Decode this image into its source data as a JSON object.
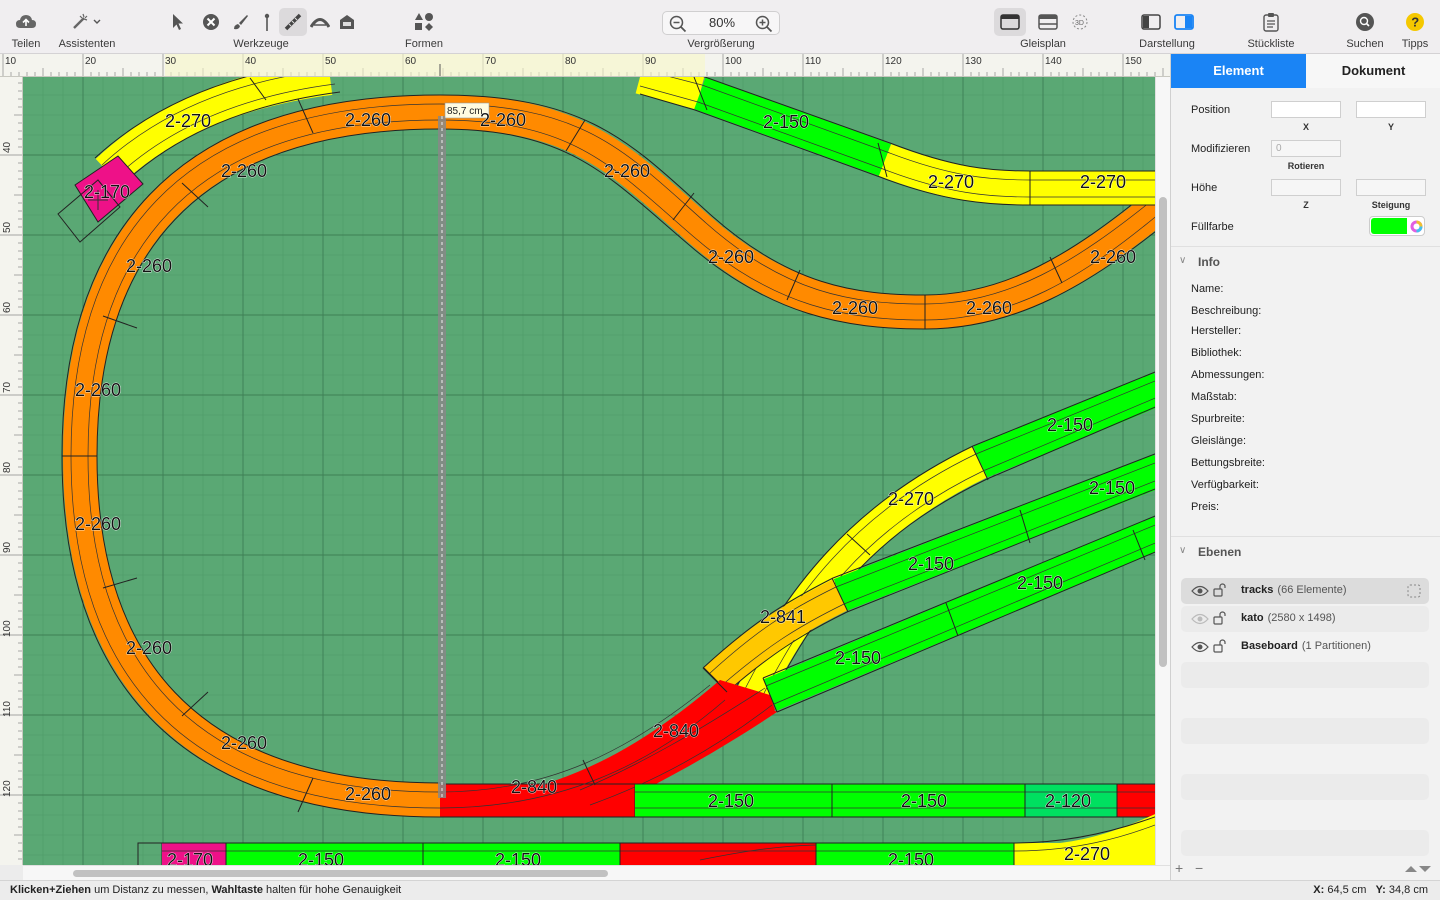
{
  "toolbar": {
    "share": "Teilen",
    "assistants": "Assistenten",
    "tools": "Werkzeuge",
    "shapes": "Formen",
    "zoom_label": "Vergrößerung",
    "zoom_value": "80%",
    "trackplan": "Gleisplan",
    "view": "Darstellung",
    "bom": "Stückliste",
    "search": "Suchen",
    "tips": "Tipps"
  },
  "ruler_top": [
    "10",
    "20",
    "30",
    "40",
    "50",
    "60",
    "70",
    "80",
    "90",
    "100",
    "110",
    "120",
    "130",
    "140",
    "150"
  ],
  "ruler_left": [
    "40",
    "50",
    "60",
    "70",
    "80",
    "90",
    "100",
    "110",
    "120"
  ],
  "canvas": {
    "measure_label": "85,7 cm",
    "colors": {
      "background": "#5aa874",
      "orange": "#ff8a00",
      "yellow": "#ffff00",
      "green": "#00ff00",
      "red": "#ff0000",
      "magenta": "#ee1188",
      "gold": "#ffc800",
      "teal_green": "#00e060"
    },
    "labels": {
      "l1": "2-270",
      "l2": "2-170",
      "l3": "2-260",
      "l4": "2-260",
      "l5": "2-260",
      "l6": "2-260",
      "l7": "2-260",
      "l8": "2-260",
      "l9": "2-260",
      "l10": "2-260",
      "l11": "2-260",
      "l12": "2-260",
      "l13": "2-260",
      "l14": "2-260",
      "l15": "2-260",
      "l16": "2-260",
      "l17": "2-150",
      "l18": "2-270",
      "l19": "2-270",
      "l20": "2-150",
      "l21": "2-150",
      "l22": "2-270",
      "l23": "2-150",
      "l24": "2-150",
      "l25": "2-841",
      "l26": "2-150",
      "l27": "2-840",
      "l28": "2-840",
      "l29": "2-150",
      "l30": "2-150",
      "l31": "2-120",
      "l32": "2-170",
      "l33": "2-150",
      "l34": "2-150",
      "l35": "2-150",
      "l36": "2-270"
    }
  },
  "status": {
    "hint_bold1": "Klicken+Ziehen",
    "hint_text1": " um Distanz zu messen, ",
    "hint_bold2": "Wahltaste",
    "hint_text2": " halten für hohe Genauigkeit",
    "x_label": "X:",
    "x_value": " 64,5 cm",
    "y_label": "Y:",
    "y_value": " 34,8 cm"
  },
  "inspector": {
    "tab_element": "Element",
    "tab_document": "Dokument",
    "position": "Position",
    "cap_x": "X",
    "cap_y": "Y",
    "modify": "Modifizieren",
    "rotate_value": "0",
    "cap_rotate": "Rotieren",
    "height": "Höhe",
    "cap_z": "Z",
    "cap_slope": "Steigung",
    "fill": "Füllfarbe",
    "fill_color": "#00ff00",
    "info_title": "Info",
    "info": {
      "name": "Name:",
      "desc": "Beschreibung:",
      "maker": "Hersteller:",
      "library": "Bibliothek:",
      "dims": "Abmessungen:",
      "scale": "Maßstab:",
      "gauge": "Spurbreite:",
      "length": "Gleislänge:",
      "bed": "Bettungsbreite:",
      "avail": "Verfügbarkeit:",
      "price": "Preis:"
    },
    "layers_title": "Ebenen",
    "layers": [
      {
        "name": "tracks",
        "meta": "(66 Elemente)"
      },
      {
        "name": "kato",
        "meta": "(2580 x 1498)"
      },
      {
        "name": "Baseboard",
        "meta": "(1 Partitionen)"
      }
    ],
    "add": "+",
    "remove": "−"
  }
}
